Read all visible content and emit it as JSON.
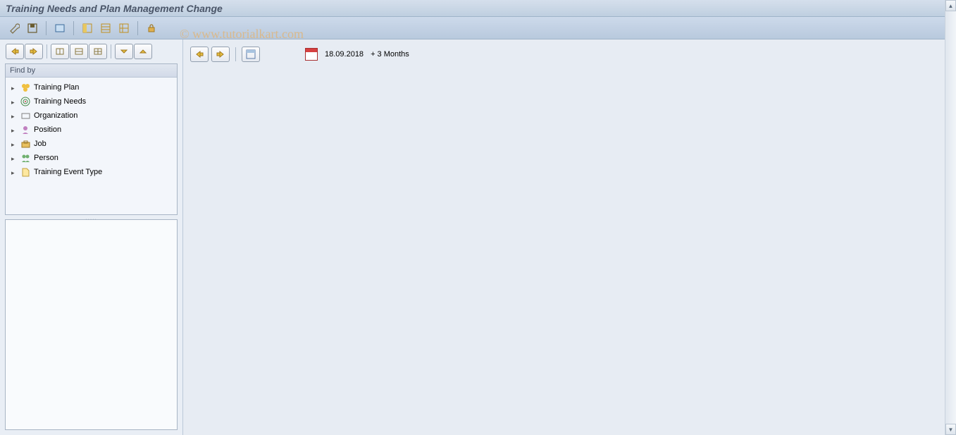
{
  "title": "Training Needs and Plan Management Change",
  "watermark": "© www.tutorialkart.com",
  "sidebar": {
    "find_by_label": "Find by",
    "items": [
      {
        "label": "Training Plan"
      },
      {
        "label": "Training Needs"
      },
      {
        "label": "Organization"
      },
      {
        "label": "Position"
      },
      {
        "label": "Job"
      },
      {
        "label": "Person"
      },
      {
        "label": "Training Event Type"
      }
    ]
  },
  "date_info": {
    "date": "18.09.2018",
    "delta": "+ 3 Months"
  }
}
